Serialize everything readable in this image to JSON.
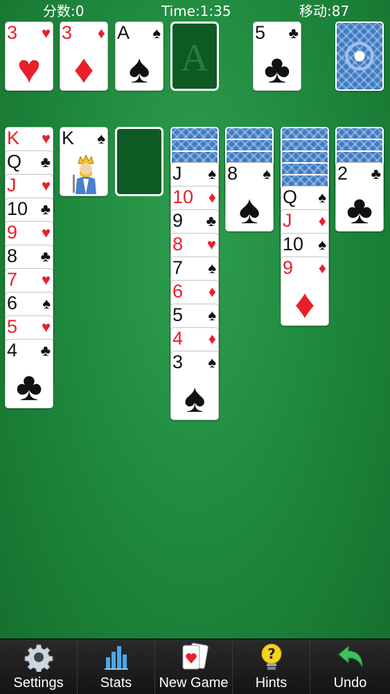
{
  "status": {
    "score": "分数:0",
    "time": "Time:1:35",
    "moves": "移动:87"
  },
  "foundations": [
    {
      "rank": "3",
      "suit": "♥",
      "color": "red"
    },
    {
      "rank": "3",
      "suit": "♦",
      "color": "red"
    },
    {
      "rank": "A",
      "suit": "♠",
      "color": "black"
    },
    {
      "empty": true,
      "placeholder": "A"
    }
  ],
  "waste": {
    "rank": "5",
    "suit": "♣",
    "color": "black"
  },
  "stock": {
    "face_down": true
  },
  "tableau": [
    {
      "hidden": 0,
      "cards": [
        {
          "rank": "K",
          "suit": "♥",
          "color": "red"
        },
        {
          "rank": "Q",
          "suit": "♣",
          "color": "black"
        },
        {
          "rank": "J",
          "suit": "♥",
          "color": "red"
        },
        {
          "rank": "10",
          "suit": "♣",
          "color": "black"
        },
        {
          "rank": "9",
          "suit": "♥",
          "color": "red"
        },
        {
          "rank": "8",
          "suit": "♣",
          "color": "black"
        },
        {
          "rank": "7",
          "suit": "♥",
          "color": "red"
        },
        {
          "rank": "6",
          "suit": "♠",
          "color": "black"
        },
        {
          "rank": "5",
          "suit": "♥",
          "color": "red"
        },
        {
          "rank": "4",
          "suit": "♣",
          "color": "black"
        }
      ]
    },
    {
      "hidden": 0,
      "cards": [
        {
          "rank": "K",
          "suit": "♠",
          "color": "black",
          "face": "king"
        }
      ]
    },
    {
      "hidden": 0,
      "cards": [],
      "empty": true
    },
    {
      "hidden": 3,
      "cards": [
        {
          "rank": "J",
          "suit": "♠",
          "color": "black"
        },
        {
          "rank": "10",
          "suit": "♦",
          "color": "red"
        },
        {
          "rank": "9",
          "suit": "♣",
          "color": "black"
        },
        {
          "rank": "8",
          "suit": "♥",
          "color": "red"
        },
        {
          "rank": "7",
          "suit": "♠",
          "color": "black"
        },
        {
          "rank": "6",
          "suit": "♦",
          "color": "red"
        },
        {
          "rank": "5",
          "suit": "♠",
          "color": "black"
        },
        {
          "rank": "4",
          "suit": "♦",
          "color": "red"
        },
        {
          "rank": "3",
          "suit": "♠",
          "color": "black"
        }
      ]
    },
    {
      "hidden": 3,
      "cards": [
        {
          "rank": "8",
          "suit": "♠",
          "color": "black"
        }
      ]
    },
    {
      "hidden": 5,
      "cards": [
        {
          "rank": "Q",
          "suit": "♠",
          "color": "black"
        },
        {
          "rank": "J",
          "suit": "♦",
          "color": "red"
        },
        {
          "rank": "10",
          "suit": "♠",
          "color": "black"
        },
        {
          "rank": "9",
          "suit": "♦",
          "color": "red"
        }
      ]
    },
    {
      "hidden": 3,
      "cards": [
        {
          "rank": "2",
          "suit": "♣",
          "color": "black"
        }
      ]
    }
  ],
  "toolbar": [
    {
      "label": "Settings",
      "icon": "gear-icon",
      "name": "settings-button"
    },
    {
      "label": "Stats",
      "icon": "bar-chart-icon",
      "name": "stats-button"
    },
    {
      "label": "New Game",
      "icon": "cards-icon",
      "name": "new-game-button"
    },
    {
      "label": "Hints",
      "icon": "lightbulb-icon",
      "name": "hints-button"
    },
    {
      "label": "Undo",
      "icon": "undo-arrow-icon",
      "name": "undo-button"
    }
  ],
  "colors": {
    "table": "#1f8a3e",
    "red_suit": "#e8202a",
    "black_suit": "#111111",
    "card_back": "#3d7bc4",
    "toolbar": "#1e1e1e"
  }
}
